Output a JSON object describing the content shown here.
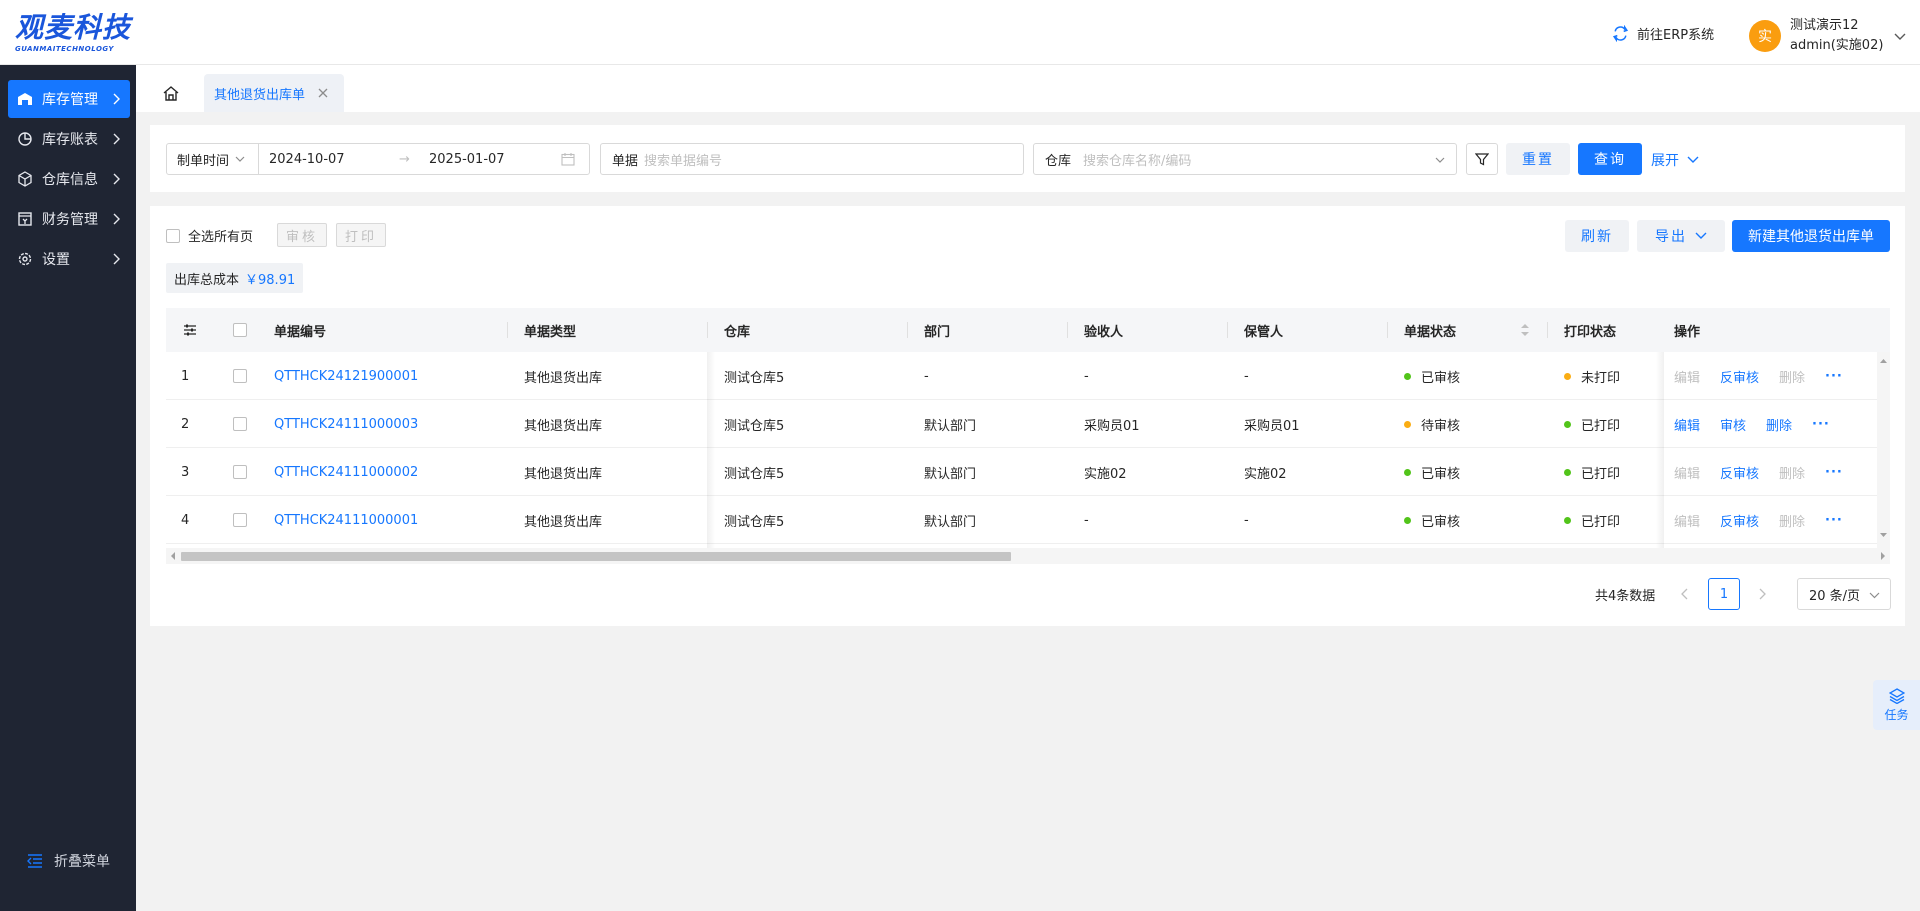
{
  "brand": {
    "name": "观麦科技",
    "sub": "GUANMAITECHNOLOGY"
  },
  "header": {
    "erp_link": "前往ERP系统",
    "avatar_char": "实",
    "user_name": "测试演示12",
    "user_account": "admin(实施02)"
  },
  "sidebar": {
    "items": [
      {
        "label": "库存管理",
        "icon": "warehouse-icon",
        "active": true
      },
      {
        "label": "库存账表",
        "icon": "pie-chart-icon",
        "active": false
      },
      {
        "label": "仓库信息",
        "icon": "cube-icon",
        "active": false
      },
      {
        "label": "财务管理",
        "icon": "finance-icon",
        "active": false
      },
      {
        "label": "设置",
        "icon": "gear-icon",
        "active": false
      }
    ],
    "collapse_label": "折叠菜单"
  },
  "tabs": {
    "active_label": "其他退货出库单"
  },
  "filter": {
    "date_type": "制单时间",
    "date_start": "2024-10-07",
    "date_end": "2025-01-07",
    "date_sep": "→",
    "order_label": "单据",
    "order_placeholder": "搜索单据编号",
    "warehouse_label": "仓库",
    "warehouse_placeholder": "搜索仓库名称/编码",
    "reset_label": "重置",
    "query_label": "查询",
    "expand_label": "展开"
  },
  "toolbar": {
    "select_all_label": "全选所有页",
    "audit_label": "审核",
    "print_label": "打印",
    "refresh_label": "刷新",
    "export_label": "导出",
    "new_label": "新建其他退货出库单"
  },
  "summary": {
    "label": "出库总成本",
    "value": "￥98.91"
  },
  "table": {
    "columns": [
      "单据编号",
      "单据类型",
      "仓库",
      "部门",
      "验收人",
      "保管人",
      "单据状态",
      "打印状态",
      "操作"
    ],
    "rows": [
      {
        "idx": "1",
        "code": "QTTHCK24121900001",
        "type": "其他退货出库",
        "warehouse": "测试仓库5",
        "dept": "-",
        "receiver": "-",
        "keeper": "-",
        "status": "已审核",
        "status_color": "#52c41a",
        "print": "未打印",
        "print_color": "#faad14",
        "actions": [
          "编辑",
          "反审核",
          "删除"
        ],
        "actions_disabled": [
          true,
          false,
          true
        ]
      },
      {
        "idx": "2",
        "code": "QTTHCK24111000003",
        "type": "其他退货出库",
        "warehouse": "测试仓库5",
        "dept": "默认部门",
        "receiver": "采购员01",
        "keeper": "采购员01",
        "status": "待审核",
        "status_color": "#faad14",
        "print": "已打印",
        "print_color": "#52c41a",
        "actions": [
          "编辑",
          "审核",
          "删除"
        ],
        "actions_disabled": [
          false,
          false,
          false
        ]
      },
      {
        "idx": "3",
        "code": "QTTHCK24111000002",
        "type": "其他退货出库",
        "warehouse": "测试仓库5",
        "dept": "默认部门",
        "receiver": "实施02",
        "keeper": "实施02",
        "status": "已审核",
        "status_color": "#52c41a",
        "print": "已打印",
        "print_color": "#52c41a",
        "actions": [
          "编辑",
          "反审核",
          "删除"
        ],
        "actions_disabled": [
          true,
          false,
          true
        ]
      },
      {
        "idx": "4",
        "code": "QTTHCK24111000001",
        "type": "其他退货出库",
        "warehouse": "测试仓库5",
        "dept": "默认部门",
        "receiver": "-",
        "keeper": "-",
        "status": "已审核",
        "status_color": "#52c41a",
        "print": "已打印",
        "print_color": "#52c41a",
        "actions": [
          "编辑",
          "反审核",
          "删除"
        ],
        "actions_disabled": [
          true,
          false,
          true
        ]
      }
    ],
    "more_label": "···"
  },
  "pagination": {
    "total_label": "共4条数据",
    "current_page": "1",
    "page_size": "20 条/页"
  },
  "task": {
    "label": "任务"
  },
  "colors": {
    "primary": "#1677ff",
    "sidebar_bg": "#1f2533",
    "success": "#52c41a",
    "warning": "#faad14"
  }
}
